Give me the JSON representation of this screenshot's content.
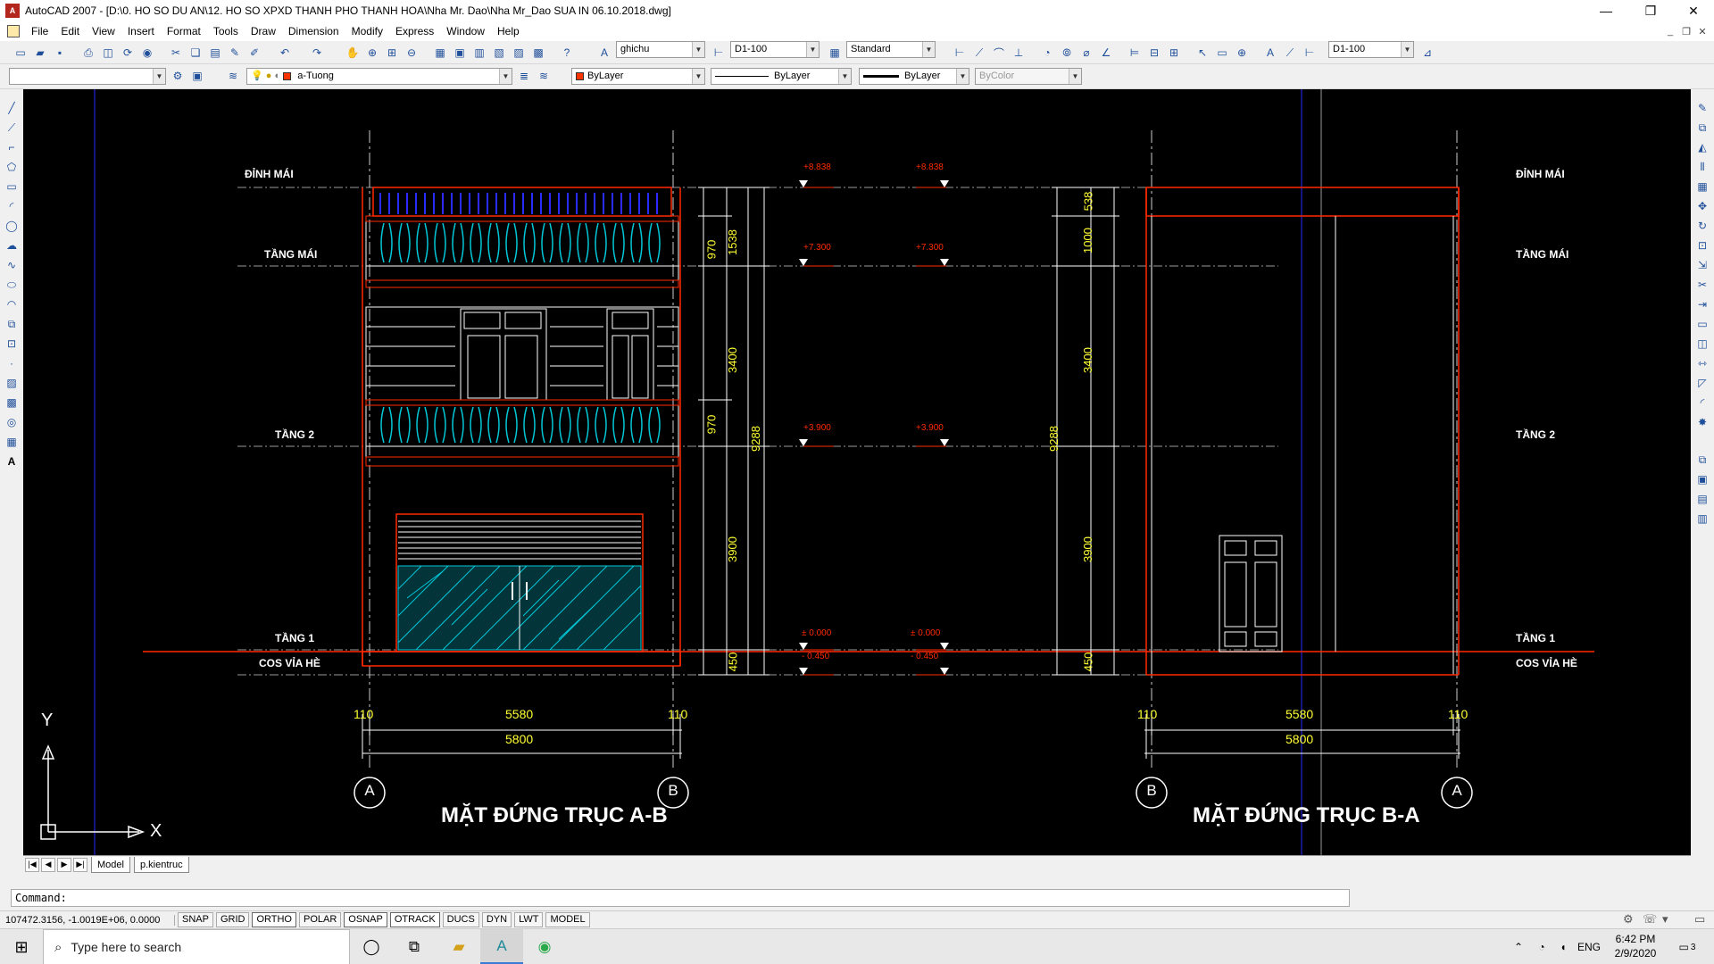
{
  "window": {
    "title": "AutoCAD 2007 - [D:\\0. HO SO DU AN\\12. HO SO XPXD THANH PHO THANH HOA\\Nha Mr. Dao\\Nha Mr_Dao SUA IN 06.10.2018.dwg]",
    "minimize": "—",
    "maximize": "❐",
    "close": "✕"
  },
  "menu": [
    "File",
    "Edit",
    "View",
    "Insert",
    "Format",
    "Tools",
    "Draw",
    "Dimension",
    "Modify",
    "Express",
    "Window",
    "Help"
  ],
  "toolbar1": {
    "text_style": "ghichu",
    "dim_style": "D1-100",
    "table_style": "Standard",
    "dim_style2": "D1-100"
  },
  "toolbar2": {
    "workspace": "",
    "layer": "a-Tuong",
    "layer_color": "#ff3300",
    "color": "ByLayer",
    "linetype": "ByLayer",
    "lineweight": "ByLayer",
    "plotstyle": "ByColor"
  },
  "drawing": {
    "levels_left": [
      "ĐỈNH MÁI",
      "TẦNG MÁI",
      "TẦNG 2",
      "TẦNG 1",
      "COS VỈA HÈ"
    ],
    "levels_right": [
      "ĐỈNH MÁI",
      "TẦNG MÁI",
      "TẦNG 2",
      "TẦNG 1",
      "COS VỈA HÈ"
    ],
    "dims_left": [
      "1538",
      "970",
      "3400",
      "970",
      "9288",
      "3900",
      "450"
    ],
    "dims_right": [
      "538",
      "1000",
      "3400",
      "9288",
      "3900",
      "450"
    ],
    "elev_marks": [
      "+8.838",
      "+7.300",
      "+3.900",
      "± 0.000",
      "- 0.450"
    ],
    "bottom_dims_ab": [
      "110",
      "5580",
      "110",
      "5800"
    ],
    "bottom_dims_ba": [
      "110",
      "5580",
      "110",
      "5800"
    ],
    "axes_ab": [
      "A",
      "B"
    ],
    "axes_ba": [
      "B",
      "A"
    ],
    "title_ab": "MẶT ĐỨNG TRỤC A-B",
    "title_ba": "MẶT ĐỨNG TRỤC B-A",
    "ucs_y": "Y",
    "ucs_x": "X",
    "colors": {
      "red": "#ff2a00",
      "cyan": "#00c8d8",
      "yellow": "#ffff33",
      "white": "#ffffff",
      "blue": "#2a2aff",
      "gray": "#9a9a9a"
    }
  },
  "tabs": [
    "Model",
    "p.kientruc"
  ],
  "command": {
    "prompt": "Command:"
  },
  "status": {
    "coords": "107472.3156, -1.0019E+06, 0.0000",
    "buttons": [
      "SNAP",
      "GRID",
      "ORTHO",
      "POLAR",
      "OSNAP",
      "OTRACK",
      "DUCS",
      "DYN",
      "LWT",
      "MODEL"
    ]
  },
  "taskbar": {
    "search_placeholder": "Type here to search",
    "lang": "ENG",
    "time": "6:42 PM",
    "date": "2/9/2020",
    "notif_count": "3"
  }
}
